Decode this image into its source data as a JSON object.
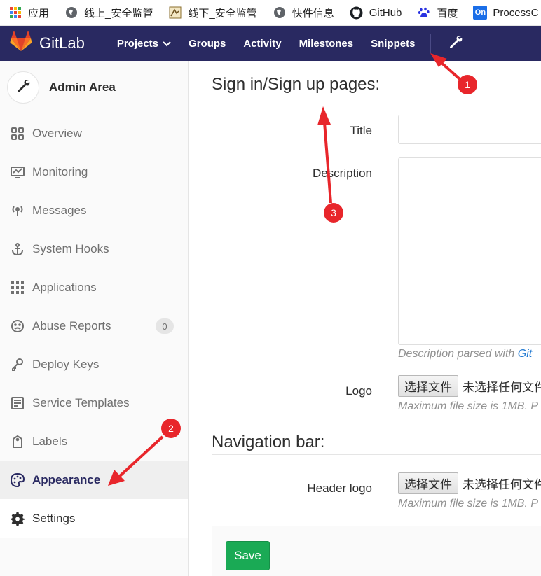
{
  "bookmarks": [
    {
      "label": "应用",
      "icon": "apps-grid-icon"
    },
    {
      "label": "线上_安全监管",
      "icon": "globe-icon"
    },
    {
      "label": "线下_安全监管",
      "icon": "page-thumbnail-icon"
    },
    {
      "label": "快件信息",
      "icon": "globe-icon"
    },
    {
      "label": "GitHub",
      "icon": "github-icon"
    },
    {
      "label": "百度",
      "icon": "baidu-paw-icon"
    },
    {
      "label": "ProcessC",
      "icon": "processon-icon"
    }
  ],
  "navbar": {
    "brand": "GitLab",
    "items": [
      "Projects",
      "Groups",
      "Activity",
      "Milestones",
      "Snippets"
    ],
    "colors": {
      "bg": "#292961",
      "accent": "#fc6d26"
    }
  },
  "sidebar": {
    "title": "Admin Area",
    "items": [
      {
        "label": "Overview",
        "icon": "overview-grid-icon"
      },
      {
        "label": "Monitoring",
        "icon": "monitoring-chart-icon"
      },
      {
        "label": "Messages",
        "icon": "broadcast-icon"
      },
      {
        "label": "System Hooks",
        "icon": "anchor-icon"
      },
      {
        "label": "Applications",
        "icon": "applications-grid-icon"
      },
      {
        "label": "Abuse Reports",
        "icon": "sad-face-icon",
        "badge": "0"
      },
      {
        "label": "Deploy Keys",
        "icon": "key-icon"
      },
      {
        "label": "Service Templates",
        "icon": "template-icon"
      },
      {
        "label": "Labels",
        "icon": "label-tag-icon"
      },
      {
        "label": "Appearance",
        "icon": "palette-icon",
        "active": true
      },
      {
        "label": "Settings",
        "icon": "gear-icon"
      }
    ]
  },
  "main": {
    "section1_title": "Sign in/Sign up pages:",
    "title_label": "Title",
    "title_value": "",
    "description_label": "Description",
    "description_value": "",
    "description_help": "Description parsed with",
    "description_help_link": "Git",
    "logo_label": "Logo",
    "file_button": "选择文件",
    "no_file": "未选择任何文件",
    "file_size_help": "Maximum file size is 1MB. P",
    "section2_title": "Navigation bar:",
    "header_logo_label": "Header logo",
    "save_button": "Save"
  },
  "annotations": {
    "markers": [
      "1",
      "2",
      "3"
    ],
    "color": "#e8262b"
  }
}
